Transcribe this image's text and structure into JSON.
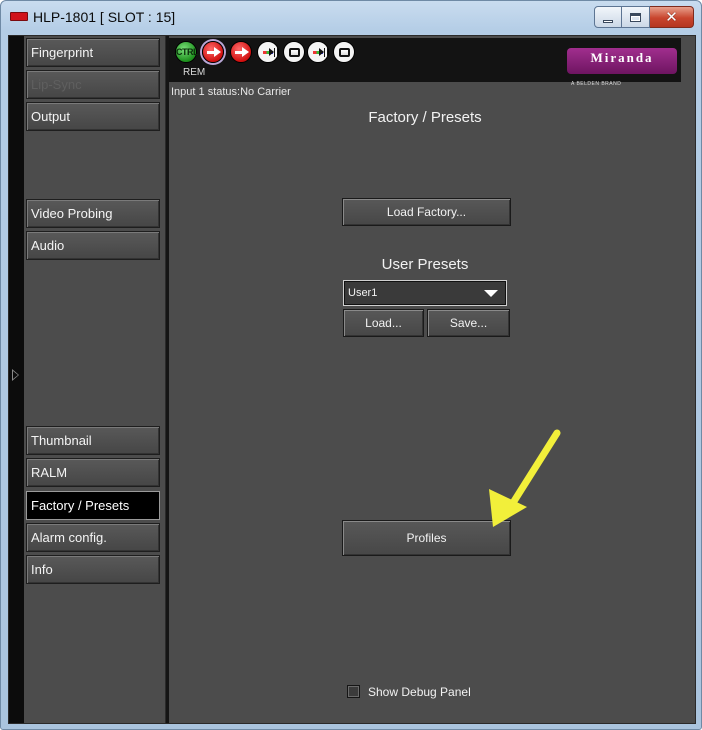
{
  "window": {
    "title": "HLP-1801 [ SLOT : 15]",
    "controls": {
      "minimize": "minimize-icon",
      "maximize": "maximize-icon",
      "close": "close-icon"
    }
  },
  "sidebar": {
    "items": [
      {
        "label": "Fingerprint",
        "state": "normal"
      },
      {
        "label": "Lip-Sync",
        "state": "disabled"
      },
      {
        "label": "Output",
        "state": "normal"
      },
      {
        "label": "Video Probing",
        "state": "normal"
      },
      {
        "label": "Audio",
        "state": "normal"
      },
      {
        "label": "Thumbnail",
        "state": "normal"
      },
      {
        "label": "RALM",
        "state": "normal"
      },
      {
        "label": "Factory / Presets",
        "state": "active"
      },
      {
        "label": "Alarm config.",
        "state": "normal"
      },
      {
        "label": "Info",
        "state": "normal"
      }
    ],
    "expand_icon": "expand-arrow-icon"
  },
  "toolbar": {
    "ctrl_label": "CTRL",
    "rem_label": "REM",
    "icons": [
      "ctrl-status-icon",
      "input-red-arrow-icon",
      "red-arrow-icon",
      "signal-pause-icon",
      "tv-status-icon",
      "signal-pause-icon",
      "tv-status-icon"
    ],
    "logo_text": "Miranda",
    "logo_subtext": "A BELDEN BRAND",
    "brand_color": "#8a2178"
  },
  "status": {
    "input_status": "Input 1 status:No Carrier"
  },
  "main": {
    "title": "Factory / Presets",
    "load_factory_label": "Load Factory...",
    "user_presets_title": "User Presets",
    "preset_select_value": "User1",
    "load_label": "Load...",
    "save_label": "Save...",
    "profiles_label": "Profiles",
    "debug_checkbox_label": "Show Debug Panel",
    "debug_checked": false
  },
  "annotation": {
    "arrow_color": "#f2ef3a",
    "target": "profiles-button"
  }
}
